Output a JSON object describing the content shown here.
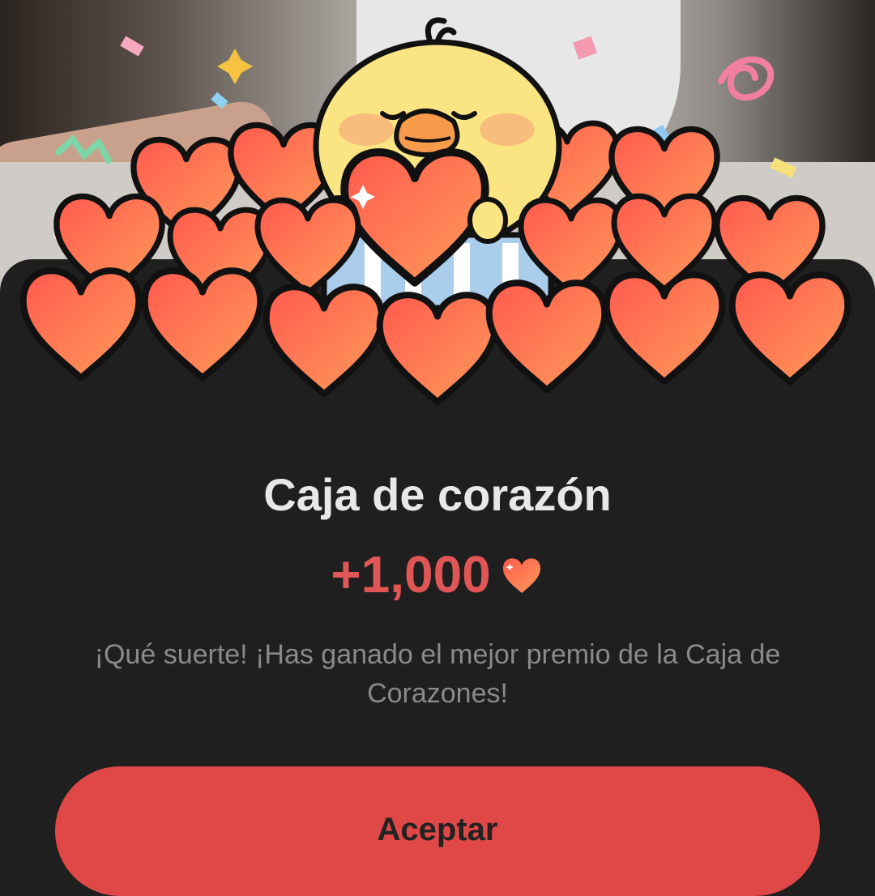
{
  "popup": {
    "title": "Caja de corazón",
    "reward_amount": "+1,000",
    "reward_icon": "heart-icon",
    "message": "¡Qué suerte! ¡Has ganado el mejor premio de la Caja de Corazones!",
    "accept_label": "Aceptar"
  },
  "colors": {
    "background": "#1f1f1f",
    "accent": "#e04848",
    "reward_text": "#e05555",
    "title_text": "#e8e8e8",
    "message_text": "#8a8a8a"
  }
}
